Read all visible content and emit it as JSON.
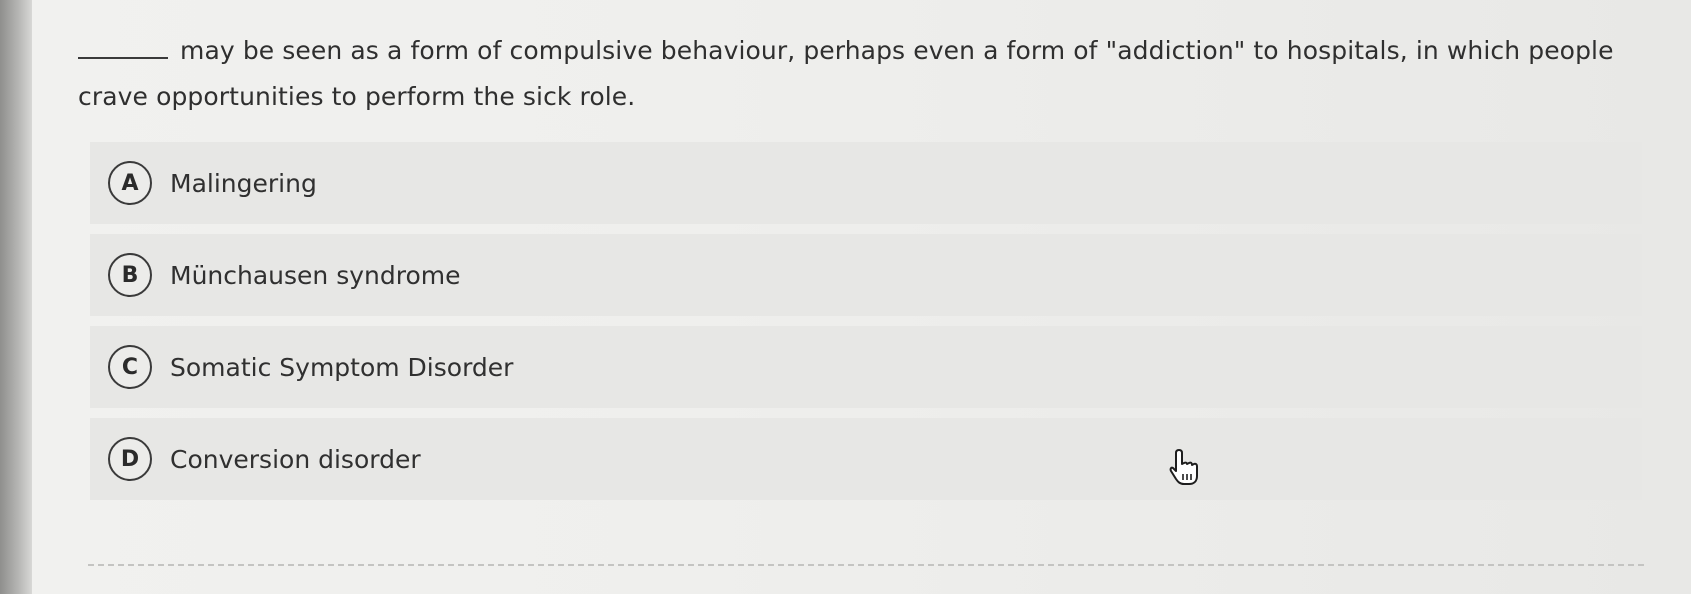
{
  "question": {
    "text": "may be seen as a form of compulsive behaviour, perhaps even a form of \"addiction\" to hospitals, in which people crave opportunities to perform the sick role."
  },
  "options": [
    {
      "letter": "A",
      "label": "Malingering"
    },
    {
      "letter": "B",
      "label": "Münchausen syndrome"
    },
    {
      "letter": "C",
      "label": "Somatic Symptom Disorder"
    },
    {
      "letter": "D",
      "label": "Conversion disorder"
    }
  ],
  "cursor": {
    "icon": "hand-pointer-icon"
  }
}
